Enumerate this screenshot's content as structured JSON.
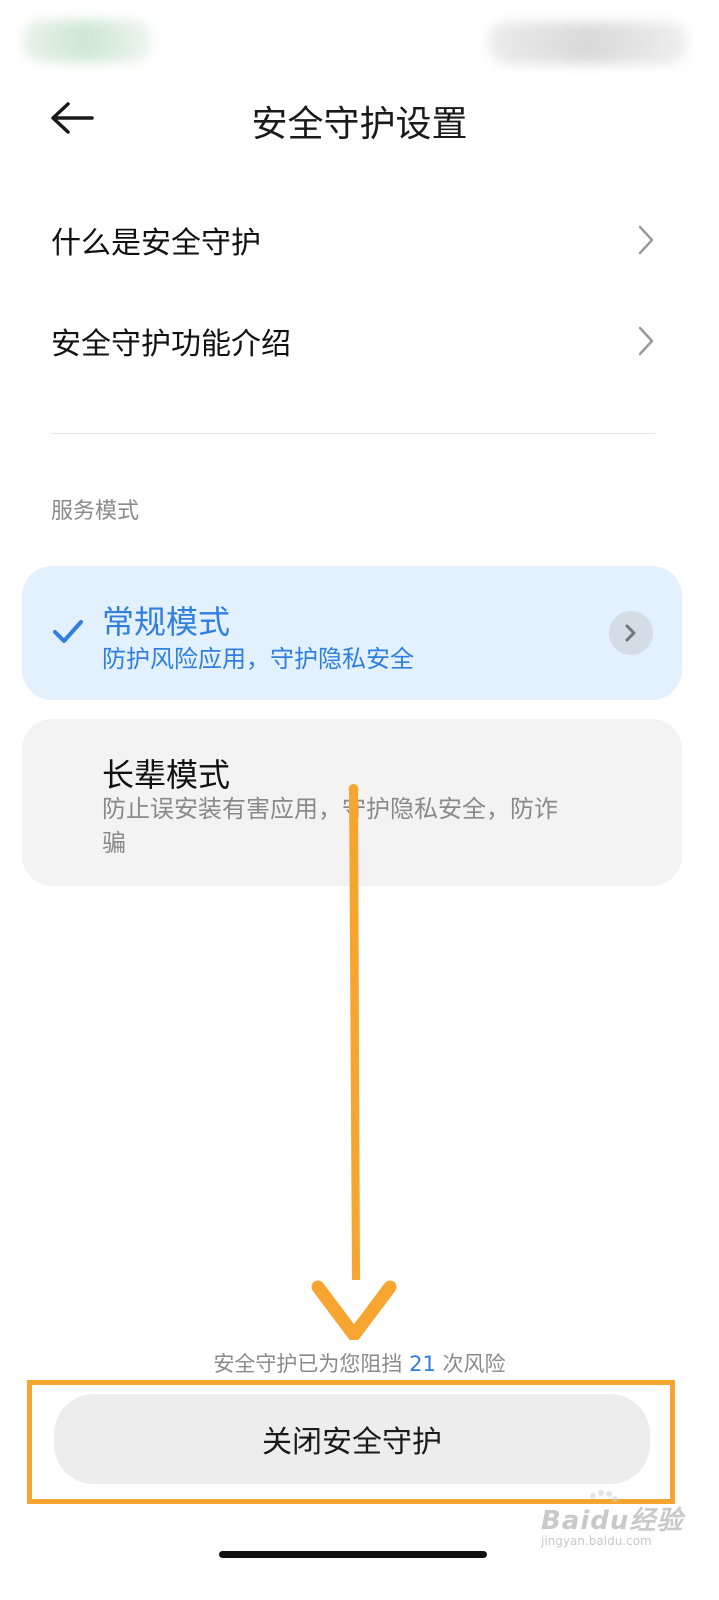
{
  "header": {
    "title": "安全守护设置",
    "back_icon": "arrow-left-icon"
  },
  "menu": {
    "items": [
      {
        "label": "什么是安全守护",
        "icon": "chevron-right-icon"
      },
      {
        "label": "安全守护功能介绍",
        "icon": "chevron-right-icon"
      }
    ]
  },
  "service": {
    "section_label": "服务模式",
    "modes": [
      {
        "title": "常规模式",
        "description": "防护风险应用，守护隐私安全",
        "selected": true
      },
      {
        "title": "长辈模式",
        "description": "防止误安装有害应用，守护隐私安全，防诈骗",
        "selected": false
      }
    ]
  },
  "footer": {
    "blocked_prefix": "安全守护已为您阻挡",
    "blocked_count": "21",
    "blocked_suffix": "次风险",
    "close_button": "关闭安全守护"
  },
  "watermark": {
    "text": "Baidu经验",
    "sub": "jingyan.baidu.com"
  },
  "colors": {
    "accent": "#2f7fe0",
    "selected_card_bg": "#e3f0fd",
    "annotation_orange": "#f6a630"
  }
}
